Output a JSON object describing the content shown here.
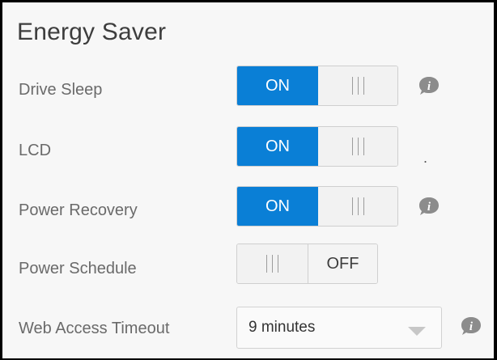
{
  "title": "Energy Saver",
  "rows": [
    {
      "label": "Drive Sleep",
      "state": "ON",
      "has_info": true
    },
    {
      "label": "LCD",
      "state": "ON",
      "has_info": false
    },
    {
      "label": "Power Recovery",
      "state": "ON",
      "has_info": true
    },
    {
      "label": "Power Schedule",
      "state": "OFF",
      "has_info": false
    },
    {
      "label": "Web Access Timeout",
      "value": "9 minutes",
      "has_info": true
    }
  ],
  "lcd_note": ".",
  "colors": {
    "accent": "#0a7fd6",
    "info_icon": "#8c8c8c"
  },
  "icons": {
    "info": "info-icon",
    "dropdown": "chevron-down-icon",
    "grip": "grip-lines-icon"
  }
}
